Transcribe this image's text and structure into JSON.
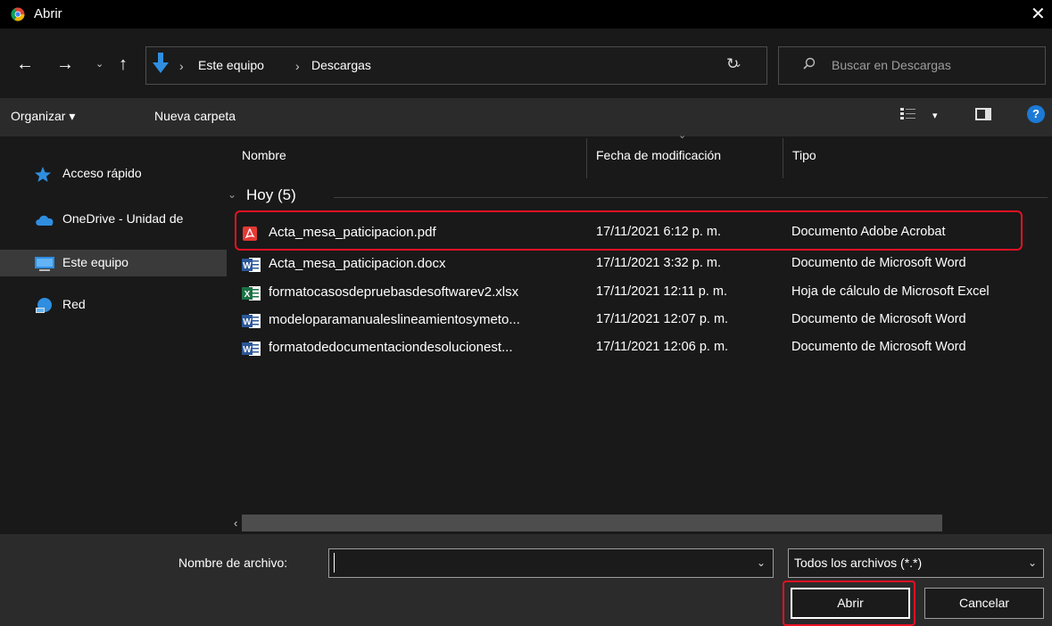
{
  "window": {
    "title": "Abrir",
    "close_glyph": "✕",
    "app_icon": "chrome-icon"
  },
  "nav": {
    "back_glyph": "←",
    "forward_glyph": "→",
    "recent_glyph": "⌄",
    "up_glyph": "↑",
    "breadcrumb": [
      "Este equipo",
      "Descargas"
    ],
    "separator": "›",
    "dropdown_glyph": "⌄",
    "refresh_glyph": "↻",
    "search_placeholder": "Buscar en Descargas"
  },
  "toolbar": {
    "organize_label": "Organizar ▾",
    "new_folder_label": "Nueva carpeta",
    "view_chevron": "▾",
    "help_label": "?"
  },
  "sidebar": {
    "items": [
      {
        "label": "Acceso rápido",
        "icon": "star-icon"
      },
      {
        "label": "OneDrive - Unidad de",
        "icon": "cloud-icon"
      },
      {
        "label": "Este equipo",
        "icon": "computer-icon",
        "selected": true
      },
      {
        "label": "Red",
        "icon": "network-icon"
      }
    ]
  },
  "columns": {
    "name": "Nombre",
    "date": "Fecha de modificación",
    "type": "Tipo",
    "sort_glyph": "⌄"
  },
  "group": {
    "label": "Hoy (5)",
    "chevron": "⌄"
  },
  "files": [
    {
      "name": "Acta_mesa_paticipacion.pdf",
      "date": "17/11/2021 6:12 p. m.",
      "type": "Documento Adobe Acrobat",
      "icon": "pdf-icon",
      "highlighted": true
    },
    {
      "name": "Acta_mesa_paticipacion.docx",
      "date": "17/11/2021 3:32 p. m.",
      "type": "Documento de Microsoft Word",
      "icon": "word-icon"
    },
    {
      "name": "formatocasosdepruebasdesoftwarev2.xlsx",
      "date": "17/11/2021 12:11 p. m.",
      "type": "Hoja de cálculo de Microsoft Excel",
      "icon": "excel-icon"
    },
    {
      "name": "modeloparamanualeslineamientosymeto...",
      "date": "17/11/2021 12:07 p. m.",
      "type": "Documento de Microsoft Word",
      "icon": "word-icon"
    },
    {
      "name": "formatodedocumentaciondesolucionest...",
      "date": "17/11/2021 12:06 p. m.",
      "type": "Documento de Microsoft Word",
      "icon": "word-icon"
    }
  ],
  "scroll": {
    "left_glyph": "‹"
  },
  "footer": {
    "filename_label": "Nombre de archivo:",
    "filename_value": "",
    "filename_dropdown": "⌄",
    "filetype_value": "Todos los archivos (*.*)",
    "filetype_chevron": "⌄",
    "open_label": "Abrir",
    "cancel_label": "Cancelar"
  },
  "colors": {
    "highlight": "#e81123",
    "selection": "#3a3a3a",
    "accent": "#1c7ad6"
  }
}
